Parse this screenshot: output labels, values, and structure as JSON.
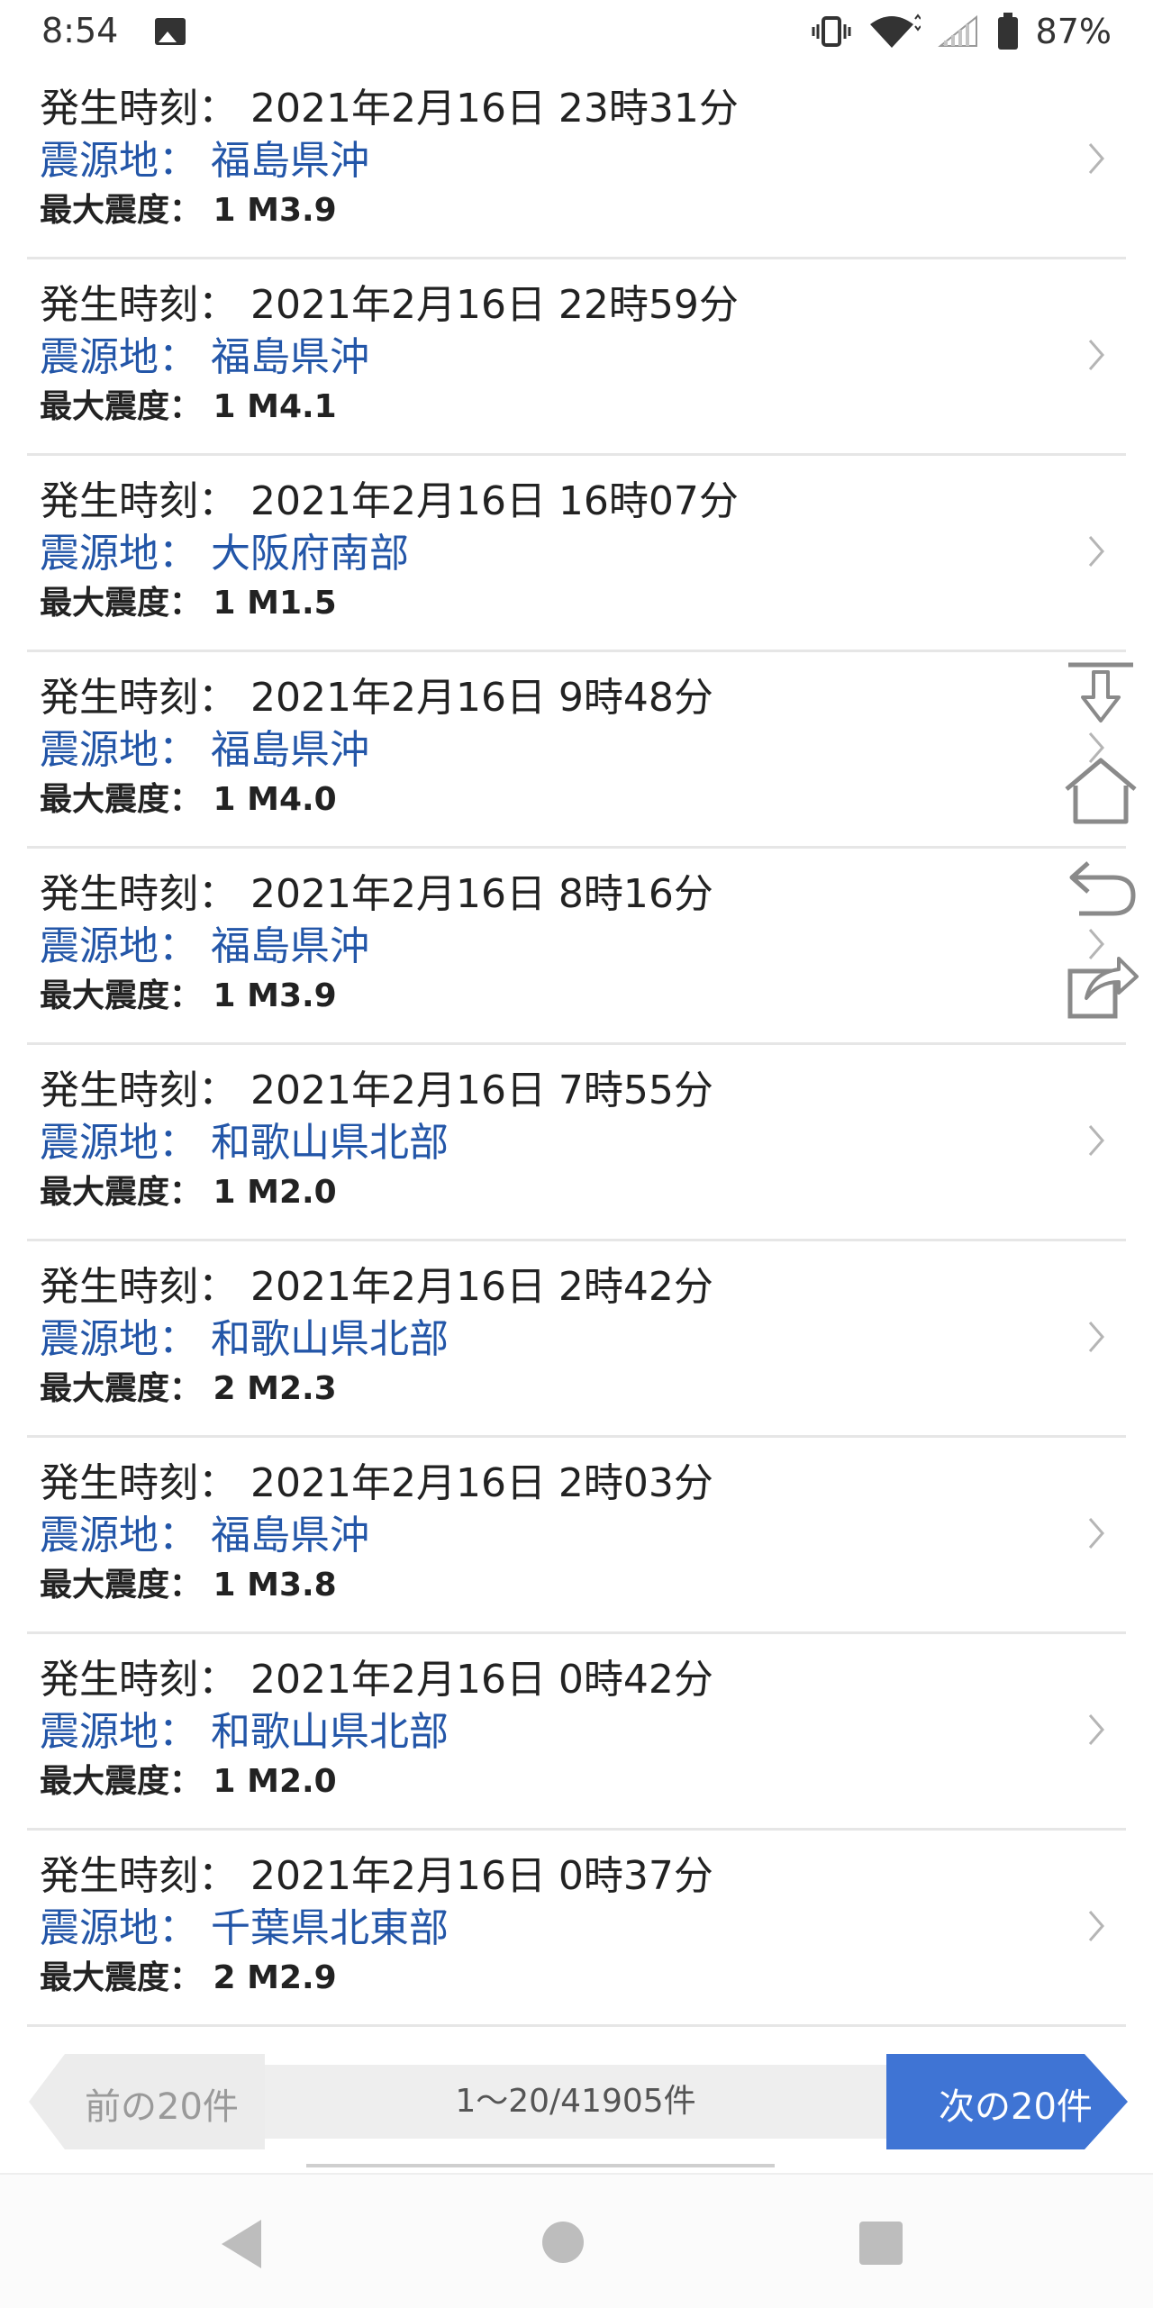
{
  "status_bar": {
    "time": "8:54",
    "battery": "87%",
    "icons": [
      "image-icon",
      "vibrate-icon",
      "wifi-icon",
      "signal-icon",
      "battery-icon"
    ]
  },
  "quakes": [
    {
      "time": "発生時刻： 2021年2月16日 23時31分",
      "epicenter": "震源地： 福島県沖",
      "magnitude": "最大震度： 1 M3.9"
    },
    {
      "time": "発生時刻： 2021年2月16日 22時59分",
      "epicenter": "震源地： 福島県沖",
      "magnitude": "最大震度： 1 M4.1"
    },
    {
      "time": "発生時刻： 2021年2月16日 16時07分",
      "epicenter": "震源地： 大阪府南部",
      "magnitude": "最大震度： 1 M1.5"
    },
    {
      "time": "発生時刻： 2021年2月16日 9時48分",
      "epicenter": "震源地： 福島県沖",
      "magnitude": "最大震度： 1 M4.0"
    },
    {
      "time": "発生時刻： 2021年2月16日 8時16分",
      "epicenter": "震源地： 福島県沖",
      "magnitude": "最大震度： 1 M3.9"
    },
    {
      "time": "発生時刻： 2021年2月16日 7時55分",
      "epicenter": "震源地： 和歌山県北部",
      "magnitude": "最大震度： 1 M2.0"
    },
    {
      "time": "発生時刻： 2021年2月16日 2時42分",
      "epicenter": "震源地： 和歌山県北部",
      "magnitude": "最大震度： 2 M2.3"
    },
    {
      "time": "発生時刻： 2021年2月16日 2時03分",
      "epicenter": "震源地： 福島県沖",
      "magnitude": "最大震度： 1 M3.8"
    },
    {
      "time": "発生時刻： 2021年2月16日 0時42分",
      "epicenter": "震源地： 和歌山県北部",
      "magnitude": "最大震度： 1 M2.0"
    },
    {
      "time": "発生時刻： 2021年2月16日 0時37分",
      "epicenter": "震源地： 千葉県北東部",
      "magnitude": "最大震度： 2 M2.9"
    }
  ],
  "float_tools": [
    "scroll-to-bottom-icon",
    "home-icon",
    "back-arrow-icon",
    "share-icon"
  ],
  "pager": {
    "prev": "前の20件",
    "count": "1〜20/41905件",
    "next": "次の20件"
  },
  "colors": {
    "link_blue": "#2356a8",
    "next_button": "#3f74d4",
    "divider": "#e6e6e6"
  }
}
